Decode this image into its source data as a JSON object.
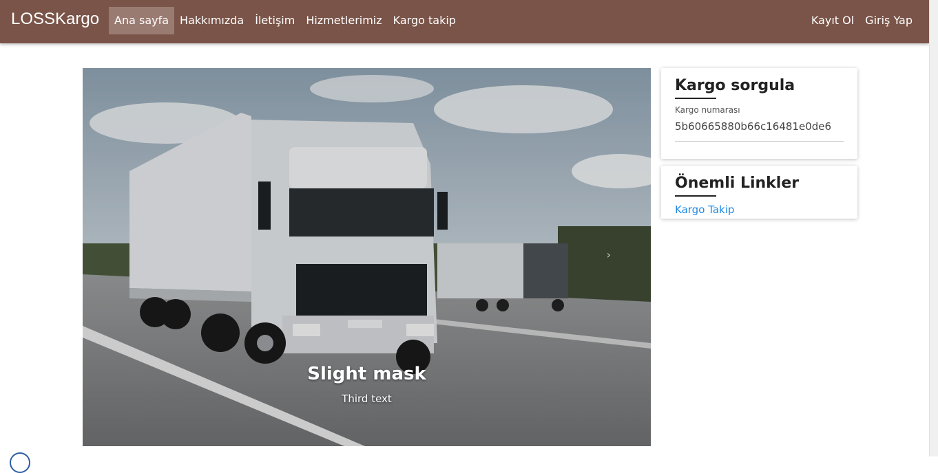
{
  "navbar": {
    "brand": "LOSSKargo",
    "left_items": [
      "Ana sayfa",
      "Hakkımızda",
      "İletişim",
      "Hizmetlerimiz",
      "Kargo takip"
    ],
    "active_index": 0,
    "right_items": [
      "Kayıt Ol",
      "Giriş Yap"
    ],
    "bg_color": "#7a5448"
  },
  "carousel": {
    "caption_title": "Slight mask",
    "caption_text": "Third text",
    "next_icon": "chevron-right-icon"
  },
  "query_card": {
    "title": "Kargo sorgula",
    "field_label": "Kargo numarası",
    "field_value": "5b60665880b66c16481e0de6"
  },
  "links_card": {
    "title": "Önemli Linkler",
    "link": "Kargo Takip",
    "link_color": "#1e88e5"
  }
}
